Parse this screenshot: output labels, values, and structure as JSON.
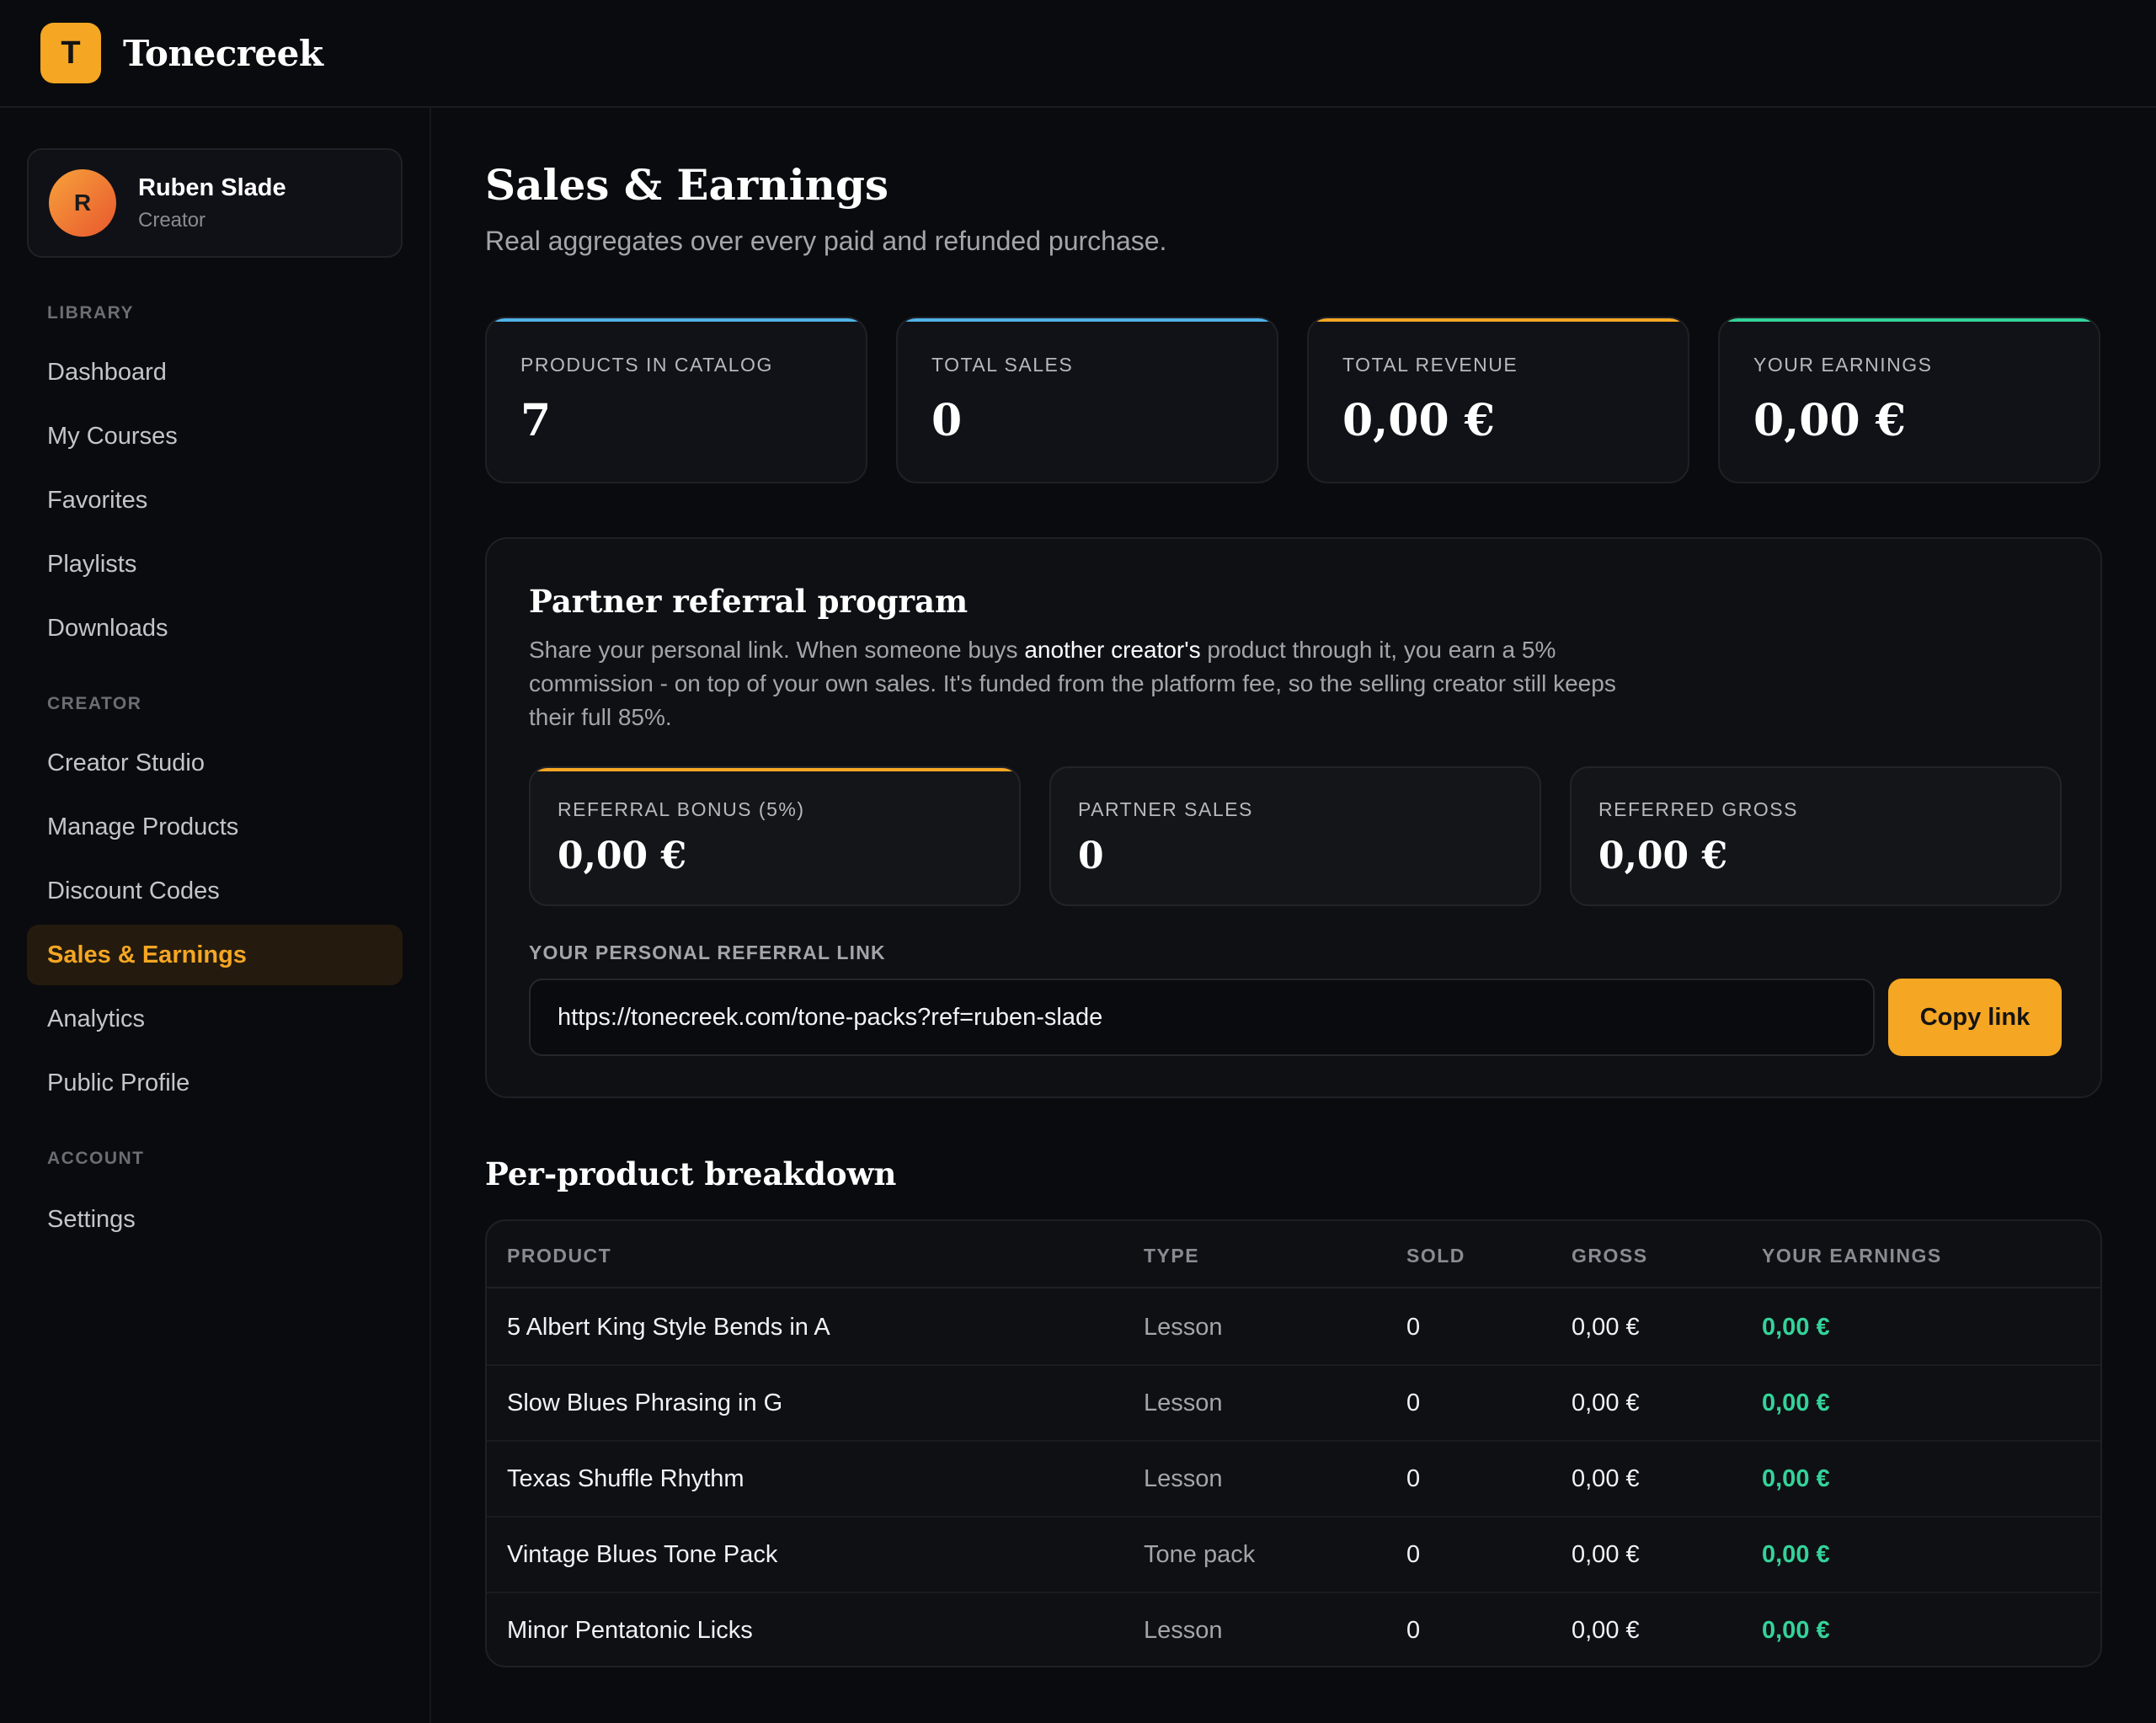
{
  "app": {
    "logo_letter": "T",
    "brand": "Tonecreek"
  },
  "user": {
    "initial": "R",
    "name": "Ruben Slade",
    "role": "Creator"
  },
  "sidebar": {
    "sections": [
      {
        "title": "LIBRARY",
        "items": [
          "Dashboard",
          "My Courses",
          "Favorites",
          "Playlists",
          "Downloads"
        ]
      },
      {
        "title": "CREATOR",
        "items": [
          "Creator Studio",
          "Manage Products",
          "Discount Codes",
          "Sales & Earnings",
          "Analytics",
          "Public Profile"
        ]
      },
      {
        "title": "ACCOUNT",
        "items": [
          "Settings"
        ]
      }
    ],
    "active": "Sales & Earnings"
  },
  "page": {
    "title": "Sales & Earnings",
    "subtitle": "Real aggregates over every paid and refunded purchase."
  },
  "stats": [
    {
      "label": "PRODUCTS IN CATALOG",
      "value": "7",
      "accent": "#4fb3e8"
    },
    {
      "label": "TOTAL SALES",
      "value": "0",
      "accent": "#4fb3e8"
    },
    {
      "label": "TOTAL REVENUE",
      "value": "0,00 €",
      "accent": "#f5a623"
    },
    {
      "label": "YOUR EARNINGS",
      "value": "0,00 €",
      "accent": "#34d399"
    }
  ],
  "referral": {
    "title": "Partner referral program",
    "desc_part1": "Share your personal link. When someone buys ",
    "desc_highlight": "another creator's",
    "desc_part2": " product through it, you earn a 5% commission - on top of your own sales. It's funded from the platform fee, so the selling creator still keeps their full 85%.",
    "stats": [
      {
        "label": "REFERRAL BONUS (5%)",
        "value": "0,00 €"
      },
      {
        "label": "PARTNER SALES",
        "value": "0"
      },
      {
        "label": "REFERRED GROSS",
        "value": "0,00 €"
      }
    ],
    "link_label": "YOUR PERSONAL REFERRAL LINK",
    "link_value": "https://tonecreek.com/tone-packs?ref=ruben-slade",
    "copy_label": "Copy link"
  },
  "breakdown": {
    "title": "Per-product breakdown",
    "columns": [
      "PRODUCT",
      "TYPE",
      "SOLD",
      "GROSS",
      "YOUR EARNINGS"
    ],
    "rows": [
      {
        "product": "5 Albert King Style Bends in A",
        "type": "Lesson",
        "sold": "0",
        "gross": "0,00 €",
        "earnings": "0,00 €"
      },
      {
        "product": "Slow Blues Phrasing in G",
        "type": "Lesson",
        "sold": "0",
        "gross": "0,00 €",
        "earnings": "0,00 €"
      },
      {
        "product": "Texas Shuffle Rhythm",
        "type": "Lesson",
        "sold": "0",
        "gross": "0,00 €",
        "earnings": "0,00 €"
      },
      {
        "product": "Vintage Blues Tone Pack",
        "type": "Tone pack",
        "sold": "0",
        "gross": "0,00 €",
        "earnings": "0,00 €"
      },
      {
        "product": "Minor Pentatonic Licks",
        "type": "Lesson",
        "sold": "0",
        "gross": "0,00 €",
        "earnings": "0,00 €"
      }
    ]
  }
}
